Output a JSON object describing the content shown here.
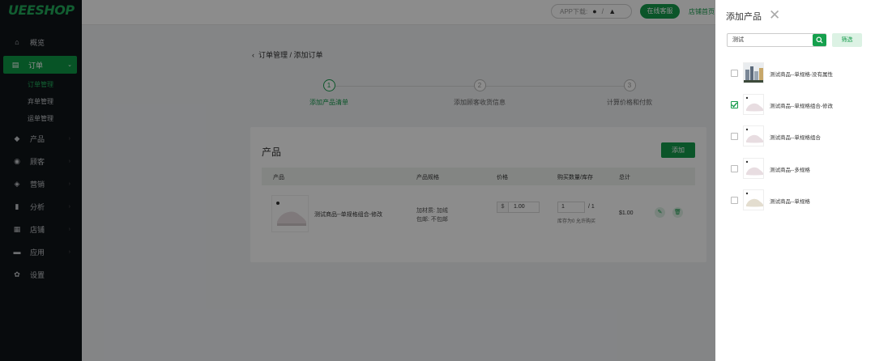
{
  "sidebar": {
    "logo": "UEESHOP",
    "items": [
      {
        "label": "概览",
        "icon": "home-icon",
        "glyph": "⌂"
      },
      {
        "label": "订单",
        "icon": "clipboard-icon",
        "glyph": "▤"
      },
      {
        "label": "产品",
        "icon": "box-icon",
        "glyph": "◆"
      },
      {
        "label": "顾客",
        "icon": "users-icon",
        "glyph": "◉"
      },
      {
        "label": "营销",
        "icon": "tag-icon",
        "glyph": "◈"
      },
      {
        "label": "分析",
        "icon": "chart-icon",
        "glyph": "▮"
      },
      {
        "label": "店铺",
        "icon": "grid-icon",
        "glyph": "▦"
      },
      {
        "label": "应用",
        "icon": "apps-icon",
        "glyph": "▬"
      },
      {
        "label": "设置",
        "icon": "gear-icon",
        "glyph": "✿"
      }
    ],
    "order_sub": [
      "订单管理",
      "弃单管理",
      "运单管理"
    ]
  },
  "topbar": {
    "app_download": "APP下载:",
    "online_service": "在线客服",
    "shop_home": "店铺首页"
  },
  "breadcrumb": "订单管理 / 添加订单",
  "steps": [
    {
      "num": "1",
      "label": "添加产品清单"
    },
    {
      "num": "2",
      "label": "添加顾客收货信息"
    },
    {
      "num": "3",
      "label": "计算价格和付款"
    }
  ],
  "products_card": {
    "title": "产品",
    "add_button": "添加",
    "columns": [
      "产品",
      "产品规格",
      "价格",
      "购买数量/库存",
      "总计"
    ],
    "row": {
      "name": "测试商品--单规格组合-修改",
      "spec_line1": "加材质: 加绒",
      "spec_line2": "包邮: 不包邮",
      "currency": "$",
      "price": "1.00",
      "qty": "1",
      "stock": "/ 1",
      "note": "库存为0 允许购买",
      "total": "$1.00"
    }
  },
  "drawer": {
    "title": "添加产品",
    "search_value": "测试",
    "filter_button": "筛选",
    "items": [
      {
        "name": "测试商品--单规格-没有属性",
        "checked": false,
        "kind": "city"
      },
      {
        "name": "测试商品--单规格组合-修改",
        "checked": true,
        "kind": "shoe"
      },
      {
        "name": "测试商品--单规格组合",
        "checked": false,
        "kind": "shoe"
      },
      {
        "name": "测试商品--多规格",
        "checked": false,
        "kind": "shoe"
      },
      {
        "name": "测试商品--单规格",
        "checked": false,
        "kind": "shoe-beige"
      }
    ]
  },
  "colors": {
    "brand": "#149b4b",
    "sidebar_bg": "#0f1419"
  }
}
